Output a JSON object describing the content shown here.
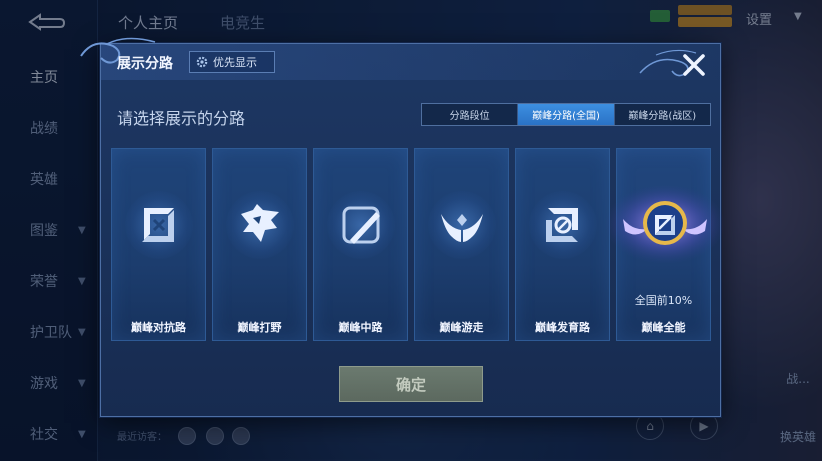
{
  "background": {
    "top_tabs": [
      {
        "label": "个人主页"
      },
      {
        "label": "电竞生"
      }
    ],
    "sidebar": {
      "items": [
        {
          "label": "主页",
          "active": true,
          "chevron": false
        },
        {
          "label": "战绩",
          "active": false,
          "chevron": false
        },
        {
          "label": "英雄",
          "active": false,
          "chevron": false
        },
        {
          "label": "图鉴",
          "active": false,
          "chevron": true
        },
        {
          "label": "荣誉",
          "active": false,
          "chevron": true
        },
        {
          "label": "护卫队",
          "active": false,
          "chevron": true
        },
        {
          "label": "游戏",
          "active": false,
          "chevron": true
        },
        {
          "label": "社交",
          "active": false,
          "chevron": true
        }
      ]
    },
    "settings_label": "设置",
    "visitors_label": "最近访客：",
    "right_labels": [
      "战...",
      "换英雄"
    ]
  },
  "modal": {
    "title": "展示分路",
    "priority_button_label": "优先显示",
    "subtitle": "请选择展示的分路",
    "tabs": [
      {
        "label": "分路段位",
        "active": false
      },
      {
        "label": "巅峰分路(全国)",
        "active": true
      },
      {
        "label": "巅峰分路(战区)",
        "active": false
      }
    ],
    "cards": [
      {
        "label": "巅峰对抗路",
        "icon": "sword-cross-icon",
        "rank": ""
      },
      {
        "label": "巅峰打野",
        "icon": "dragon-icon",
        "rank": ""
      },
      {
        "label": "巅峰中路",
        "icon": "staff-icon",
        "rank": ""
      },
      {
        "label": "巅峰游走",
        "icon": "wings-icon",
        "rank": ""
      },
      {
        "label": "巅峰发育路",
        "icon": "target-icon",
        "rank": ""
      },
      {
        "label": "巅峰全能",
        "icon": "all-round-badge-icon",
        "rank": "全国前10%"
      }
    ],
    "confirm_label": "确定"
  },
  "colors": {
    "modal_bg": "#1a3159",
    "active_tab": "#2a72c6",
    "card_bg": "#1c3d6e",
    "confirm_btn": "#5c695f"
  }
}
